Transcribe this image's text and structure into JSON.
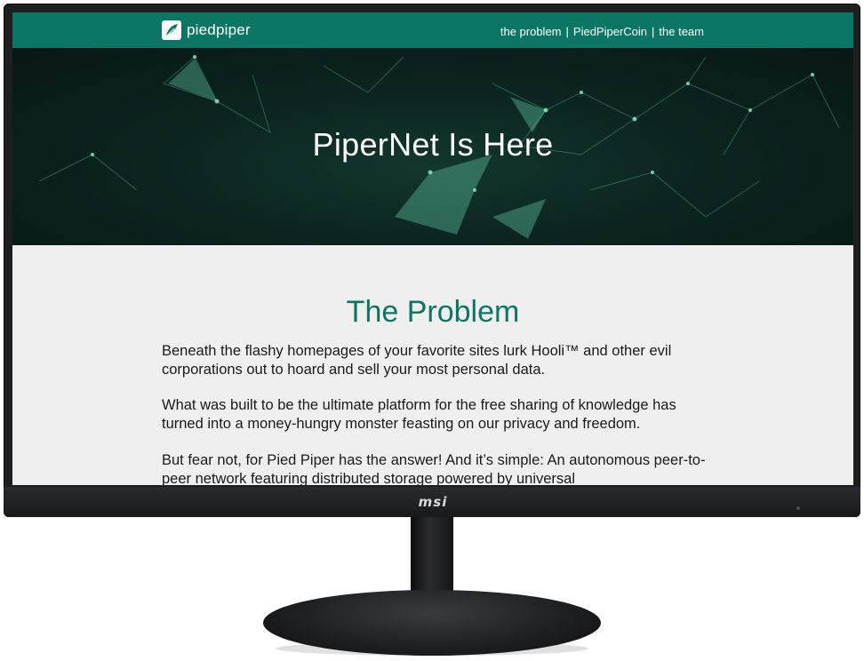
{
  "header": {
    "logo_text": "piedpiper",
    "nav": [
      "the problem",
      "PiedPiperCoin",
      "the team"
    ]
  },
  "hero": {
    "title": "PiperNet Is Here"
  },
  "section": {
    "title": "The Problem",
    "paragraphs": [
      "Beneath the flashy homepages of your favorite sites lurk Hooli™ and other evil corporations out to hoard and sell your most personal data.",
      "What was built to be the ultimate platform for the free sharing of knowledge has turned into a money-hungry monster feasting on our privacy and freedom.",
      "But fear not, for Pied Piper has the answer! And it’s simple: An autonomous peer-to-peer network featuring distributed storage powered by universal"
    ]
  },
  "monitor": {
    "brand": "msi"
  },
  "colors": {
    "brand_green": "#0c7665",
    "page_bg": "#efefef",
    "hero_bg": "#0c2421"
  }
}
